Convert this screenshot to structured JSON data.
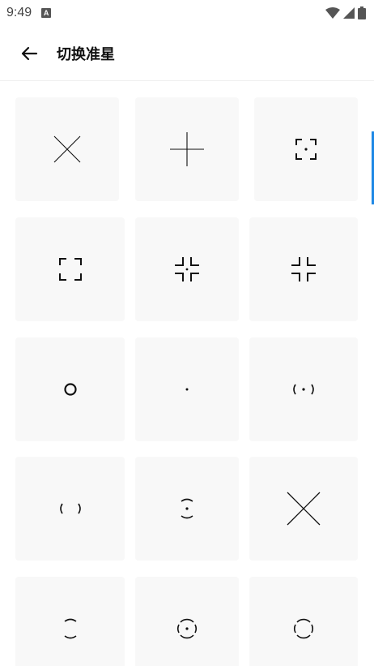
{
  "status_bar": {
    "time": "9:49",
    "badge": "A"
  },
  "app_bar": {
    "title": "切换准星"
  },
  "crosshairs": [
    {
      "icon": "x-cross-icon"
    },
    {
      "icon": "plus-cross-icon"
    },
    {
      "icon": "bracket-dot-icon"
    },
    {
      "icon": "bracket-corners-icon"
    },
    {
      "icon": "corner-ticks-dot-icon"
    },
    {
      "icon": "corner-ticks-icon"
    },
    {
      "icon": "ring-icon"
    },
    {
      "icon": "dot-icon"
    },
    {
      "icon": "paren-dot-icon"
    },
    {
      "icon": "paren-icon"
    },
    {
      "icon": "arc-dot-icon"
    },
    {
      "icon": "large-x-cross-icon"
    },
    {
      "icon": "arc-icon"
    },
    {
      "icon": "split-circle-dot-icon"
    },
    {
      "icon": "split-circle-icon"
    }
  ]
}
